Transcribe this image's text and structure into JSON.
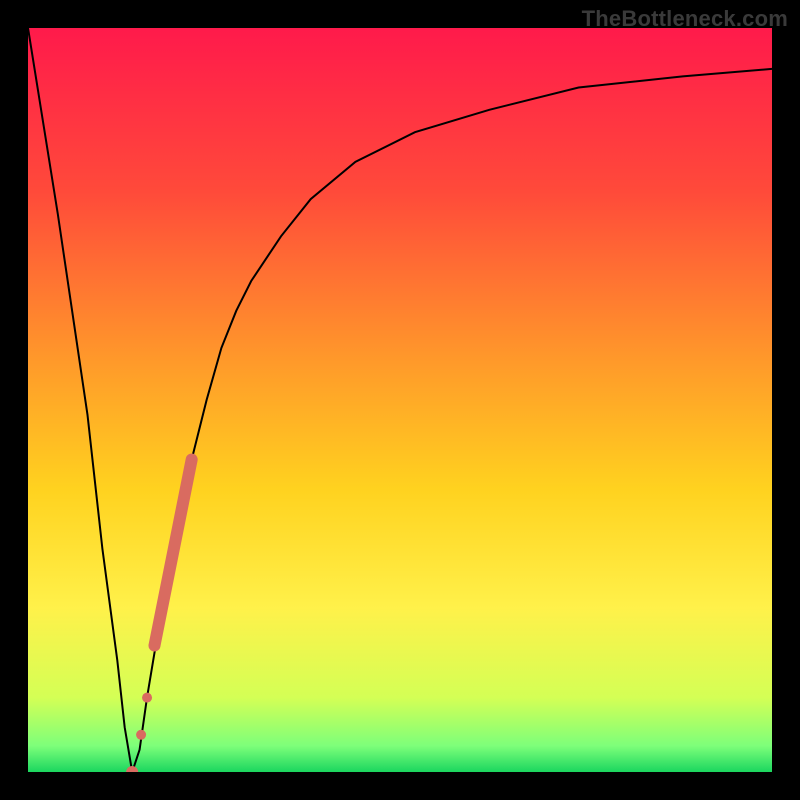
{
  "watermark": "TheBottleneck.com",
  "colors": {
    "frame": "#000000",
    "curve": "#000000",
    "marker": "#d96b60",
    "gradient_stops": [
      {
        "offset": 0.0,
        "color": "#ff1a4b"
      },
      {
        "offset": 0.22,
        "color": "#ff4a3a"
      },
      {
        "offset": 0.45,
        "color": "#ff9a2a"
      },
      {
        "offset": 0.62,
        "color": "#ffd21f"
      },
      {
        "offset": 0.78,
        "color": "#fff14a"
      },
      {
        "offset": 0.9,
        "color": "#d4ff55"
      },
      {
        "offset": 0.965,
        "color": "#7dff7a"
      },
      {
        "offset": 1.0,
        "color": "#1bd65f"
      }
    ]
  },
  "chart_data": {
    "type": "line",
    "title": "",
    "xlabel": "",
    "ylabel": "",
    "xlim": [
      0,
      100
    ],
    "ylim": [
      0,
      100
    ],
    "series": [
      {
        "name": "bottleneck-curve",
        "x": [
          0,
          4,
          8,
          10,
          12,
          13,
          14,
          15,
          16,
          18,
          20,
          22,
          24,
          26,
          28,
          30,
          34,
          38,
          44,
          52,
          62,
          74,
          88,
          100
        ],
        "y": [
          100,
          75,
          48,
          30,
          15,
          6,
          0,
          3,
          10,
          22,
          33,
          42,
          50,
          57,
          62,
          66,
          72,
          77,
          82,
          86,
          89,
          92,
          93.5,
          94.5
        ]
      }
    ],
    "markers": [
      {
        "name": "highlight-segment",
        "x_start": 17,
        "y_start": 17,
        "x_end": 22,
        "y_end": 42,
        "width": 12
      },
      {
        "name": "highlight-gap-dot-1",
        "x": 15.2,
        "y": 5,
        "r": 5
      },
      {
        "name": "highlight-gap-dot-2",
        "x": 16.0,
        "y": 10,
        "r": 5
      },
      {
        "name": "highlight-min-dot",
        "x": 14.0,
        "y": 0,
        "r": 6
      }
    ]
  }
}
